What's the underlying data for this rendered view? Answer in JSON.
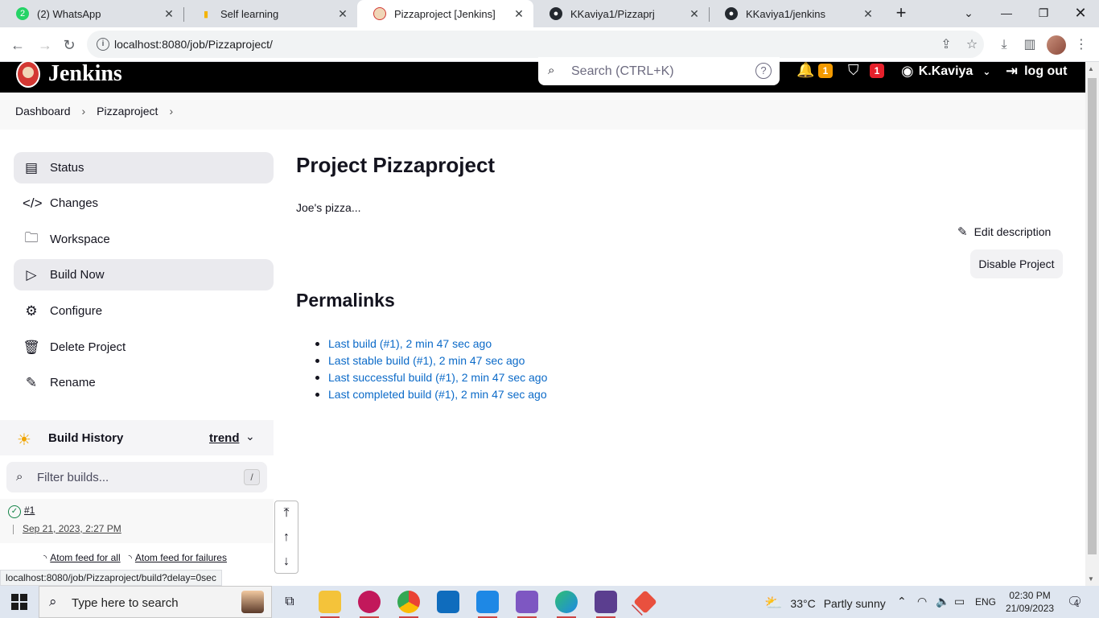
{
  "browser": {
    "tabs": [
      {
        "title": "(2) WhatsApp",
        "icon": "whatsapp-icon",
        "color": "#25d366",
        "active": false
      },
      {
        "title": "Self learning",
        "icon": "analytics-icon",
        "color": "#f4b400",
        "active": false
      },
      {
        "title": "Pizzaproject [Jenkins]",
        "icon": "jenkins-icon",
        "color": "#d33833",
        "active": true
      },
      {
        "title": "KKaviya1/Pizzaprj",
        "icon": "github-icon",
        "color": "#24292f",
        "active": false
      },
      {
        "title": "KKaviya1/jenkins",
        "icon": "github-icon",
        "color": "#24292f",
        "active": false
      }
    ],
    "url": "localhost:8080/job/Pizzaproject/",
    "status_link": "localhost:8080/job/Pizzaproject/build?delay=0sec"
  },
  "header": {
    "brand": "Jenkins",
    "search_placeholder": "Search (CTRL+K)",
    "notifications_count": "1",
    "security_count": "1",
    "user": "K.Kaviya",
    "logout": "log out"
  },
  "breadcrumb": {
    "items": [
      "Dashboard",
      "Pizzaproject"
    ]
  },
  "sidebar": {
    "items": [
      {
        "label": "Status",
        "icon": "status-icon"
      },
      {
        "label": "Changes",
        "icon": "code-icon"
      },
      {
        "label": "Workspace",
        "icon": "folder-icon"
      },
      {
        "label": "Build Now",
        "icon": "play-icon"
      },
      {
        "label": "Configure",
        "icon": "gear-icon"
      },
      {
        "label": "Delete Project",
        "icon": "trash-icon"
      },
      {
        "label": "Rename",
        "icon": "pencil-icon"
      }
    ]
  },
  "build_history": {
    "title": "Build History",
    "trend": "trend",
    "filter_placeholder": "Filter builds...",
    "filter_shortcut": "/",
    "builds": [
      {
        "number": "#1",
        "date": "Sep 21, 2023, 2:27 PM",
        "status": "success"
      }
    ],
    "feed_all": "Atom feed for all",
    "feed_failures": "Atom feed for failures"
  },
  "main": {
    "title": "Project Pizzaproject",
    "description": "Joe's pizza...",
    "edit_description": "Edit description",
    "disable_button": "Disable Project",
    "permalinks_title": "Permalinks",
    "permalinks": [
      "Last build (#1), 2 min 47 sec ago",
      "Last stable build (#1), 2 min 47 sec ago",
      "Last successful build (#1), 2 min 47 sec ago",
      "Last completed build (#1), 2 min 47 sec ago"
    ]
  },
  "taskbar": {
    "search_placeholder": "Type here to search",
    "weather_temp": "33°C",
    "weather_text": "Partly sunny",
    "language": "ENG",
    "time": "02:30 PM",
    "date": "21/09/2023",
    "notification_count": "4"
  },
  "colors": {
    "link": "#0b6ac8",
    "header_bg": "#000000",
    "badge_warning": "#f39a00",
    "badge_danger": "#e6202b",
    "success": "#138347"
  }
}
